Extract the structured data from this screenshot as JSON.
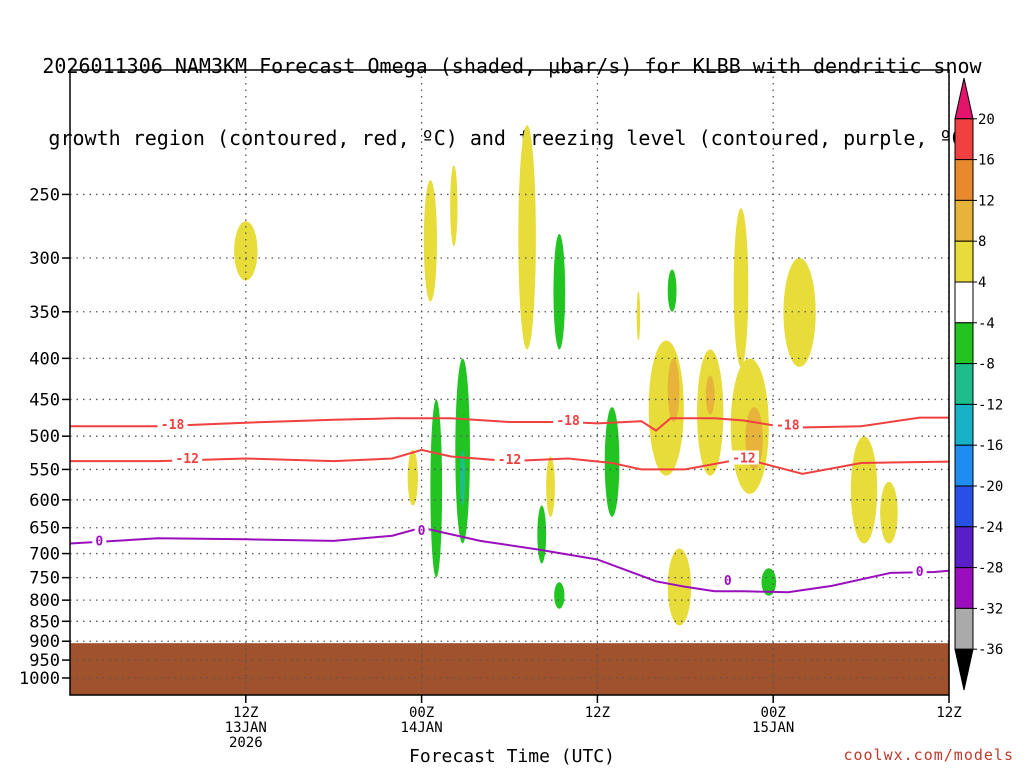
{
  "title_lines": [
    "2026011306 NAM3KM Forecast Omega (shaded, μbar/s) for KLBB with dendritic snow",
    "growth region (contoured, red, ºC) and freezing level (contoured, purple, ºC)"
  ],
  "credit": "coolwx.com/models",
  "chart_data": {
    "type": "heatmap",
    "xlabel": "Forecast Time (UTC)",
    "x_unit": "forecast hour",
    "xlim": [
      -6,
      54
    ],
    "x_ticks": [
      {
        "hour": 6,
        "label": [
          "12Z",
          "13JAN",
          "2026"
        ]
      },
      {
        "hour": 18,
        "label": [
          "00Z",
          "14JAN"
        ]
      },
      {
        "hour": 30,
        "label": [
          "12Z"
        ]
      },
      {
        "hour": 42,
        "label": [
          "00Z",
          "15JAN"
        ]
      },
      {
        "hour": 54,
        "label": [
          "12Z"
        ]
      }
    ],
    "ylabel": "",
    "y_unit": "hPa",
    "ylim": [
      1050,
      175
    ],
    "y_ticks": [
      250,
      300,
      350,
      400,
      450,
      500,
      550,
      600,
      650,
      700,
      750,
      800,
      850,
      900,
      950,
      1000
    ],
    "grid": true,
    "colorbar": {
      "labels": [
        "20",
        "16",
        "12",
        "8",
        "4",
        "-4",
        "-8",
        "-12",
        "-16",
        "-20",
        "-24",
        "-28",
        "-32",
        "-36"
      ],
      "colors": [
        "#e4146c",
        "#f04040",
        "#e8892e",
        "#e8b33a",
        "#e8dc3a",
        "#ffffff",
        "#22c422",
        "#1dbe8c",
        "#17b2c8",
        "#1e8cf0",
        "#2850e6",
        "#5a1ec8",
        "#9b0ebe",
        "#aaaaaa",
        "#000000"
      ]
    },
    "ground": {
      "color": "#a0522d",
      "top_hpa": 905
    },
    "isotherms": [
      {
        "label": "-18",
        "color": "#f04040",
        "points": [
          [
            -6,
            486
          ],
          [
            0,
            486
          ],
          [
            6,
            481
          ],
          [
            12,
            477
          ],
          [
            16,
            475
          ],
          [
            20,
            475
          ],
          [
            24,
            480
          ],
          [
            28,
            480
          ],
          [
            30,
            482
          ],
          [
            33,
            479
          ],
          [
            34,
            492
          ],
          [
            35,
            475
          ],
          [
            38,
            475
          ],
          [
            40,
            478
          ],
          [
            43,
            488
          ],
          [
            48,
            486
          ],
          [
            52,
            474
          ],
          [
            56,
            474
          ],
          [
            60,
            467
          ]
        ],
        "label_at": [
          [
            1,
            484
          ],
          [
            28,
            479
          ],
          [
            43,
            485
          ]
        ]
      },
      {
        "label": "-12",
        "color": "#f04040",
        "points": [
          [
            -6,
            537
          ],
          [
            0,
            537
          ],
          [
            6,
            533
          ],
          [
            12,
            537
          ],
          [
            16,
            533
          ],
          [
            18,
            520
          ],
          [
            20,
            530
          ],
          [
            24,
            537
          ],
          [
            28,
            533
          ],
          [
            31,
            540
          ],
          [
            33,
            550
          ],
          [
            36,
            550
          ],
          [
            40,
            533
          ],
          [
            44,
            557
          ],
          [
            48,
            540
          ],
          [
            56,
            537
          ],
          [
            60,
            520
          ]
        ],
        "label_at": [
          [
            2,
            534
          ],
          [
            24,
            535
          ],
          [
            40,
            533
          ]
        ]
      },
      {
        "label": "0",
        "color": "#9b0ebe",
        "points": [
          [
            -6,
            680
          ],
          [
            0,
            670
          ],
          [
            6,
            672
          ],
          [
            12,
            675
          ],
          [
            16,
            665
          ],
          [
            18,
            650
          ],
          [
            22,
            675
          ],
          [
            26,
            692
          ],
          [
            30,
            712
          ],
          [
            34,
            758
          ],
          [
            36,
            770
          ],
          [
            38,
            780
          ],
          [
            40,
            780
          ],
          [
            43,
            782
          ],
          [
            46,
            768
          ],
          [
            50,
            740
          ],
          [
            53,
            738
          ],
          [
            56,
            730
          ],
          [
            57,
            685
          ],
          [
            60,
            668
          ]
        ],
        "label_at": [
          [
            -4,
            676
          ],
          [
            18,
            656
          ],
          [
            52,
            738
          ]
        ]
      },
      {
        "label": "0",
        "color": "#9b0ebe",
        "points": [
          [
            38.6,
            760
          ],
          [
            39.2,
            762
          ]
        ],
        "label_at": [
          [
            38.9,
            757
          ]
        ]
      }
    ],
    "omega_regions": [
      {
        "value": 4,
        "color": "#e8dc3a",
        "center": [
          6,
          290
        ],
        "half_width_h": 0.8,
        "p_range": [
          270,
          320
        ]
      },
      {
        "value": 4,
        "color": "#e8dc3a",
        "center": [
          18.6,
          290
        ],
        "half_width_h": 0.45,
        "p_range": [
          240,
          340
        ]
      },
      {
        "value": 4,
        "color": "#e8dc3a",
        "center": [
          20.2,
          260
        ],
        "half_width_h": 0.25,
        "p_range": [
          230,
          290
        ]
      },
      {
        "value": 4,
        "color": "#e8dc3a",
        "center": [
          25.2,
          270
        ],
        "half_width_h": 0.6,
        "p_range": [
          205,
          390
        ]
      },
      {
        "value": 4,
        "color": "#e8dc3a",
        "center": [
          17.4,
          560
        ],
        "half_width_h": 0.35,
        "p_range": [
          520,
          610
        ]
      },
      {
        "value": 4,
        "color": "#e8dc3a",
        "center": [
          26.8,
          575
        ],
        "half_width_h": 0.3,
        "p_range": [
          530,
          630
        ]
      },
      {
        "value": 4,
        "color": "#e8dc3a",
        "center": [
          32.8,
          350
        ],
        "half_width_h": 0.12,
        "p_range": [
          330,
          380
        ]
      },
      {
        "value": 4,
        "color": "#e8dc3a",
        "center": [
          34.7,
          450
        ],
        "half_width_h": 1.2,
        "p_range": [
          380,
          560
        ]
      },
      {
        "value": 4,
        "color": "#e8dc3a",
        "center": [
          37.7,
          440
        ],
        "half_width_h": 0.9,
        "p_range": [
          390,
          560
        ]
      },
      {
        "value": 4,
        "color": "#e8dc3a",
        "center": [
          40.4,
          480
        ],
        "half_width_h": 1.3,
        "p_range": [
          400,
          590
        ]
      },
      {
        "value": 4,
        "color": "#e8dc3a",
        "center": [
          39.8,
          320
        ],
        "half_width_h": 0.5,
        "p_range": [
          260,
          410
        ]
      },
      {
        "value": 4,
        "color": "#e8dc3a",
        "center": [
          43.8,
          340
        ],
        "half_width_h": 1.1,
        "p_range": [
          300,
          410
        ]
      },
      {
        "value": 4,
        "color": "#e8dc3a",
        "center": [
          35.6,
          770
        ],
        "half_width_h": 0.8,
        "p_range": [
          690,
          860
        ]
      },
      {
        "value": 4,
        "color": "#e8dc3a",
        "center": [
          48.2,
          590
        ],
        "half_width_h": 0.9,
        "p_range": [
          500,
          680
        ]
      },
      {
        "value": 4,
        "color": "#e8dc3a",
        "center": [
          49.9,
          620
        ],
        "half_width_h": 0.6,
        "p_range": [
          570,
          680
        ]
      },
      {
        "value": 8,
        "color": "#e8b33a",
        "center": [
          35.2,
          440
        ],
        "half_width_h": 0.4,
        "p_range": [
          400,
          480
        ]
      },
      {
        "value": 8,
        "color": "#e8b33a",
        "center": [
          37.7,
          440
        ],
        "half_width_h": 0.3,
        "p_range": [
          420,
          470
        ]
      },
      {
        "value": 8,
        "color": "#e8b33a",
        "center": [
          40.7,
          500
        ],
        "half_width_h": 0.6,
        "p_range": [
          460,
          550
        ]
      },
      {
        "value": -4,
        "color": "#22c422",
        "center": [
          19.0,
          600
        ],
        "half_width_h": 0.4,
        "p_range": [
          450,
          750
        ]
      },
      {
        "value": -4,
        "color": "#22c422",
        "center": [
          20.8,
          520
        ],
        "half_width_h": 0.5,
        "p_range": [
          400,
          680
        ]
      },
      {
        "value": -4,
        "color": "#22c422",
        "center": [
          27.4,
          335
        ],
        "half_width_h": 0.4,
        "p_range": [
          280,
          390
        ]
      },
      {
        "value": -4,
        "color": "#22c422",
        "center": [
          31.0,
          510
        ],
        "half_width_h": 0.5,
        "p_range": [
          460,
          630
        ]
      },
      {
        "value": -4,
        "color": "#22c422",
        "center": [
          26.2,
          660
        ],
        "half_width_h": 0.3,
        "p_range": [
          610,
          720
        ]
      },
      {
        "value": -4,
        "color": "#22c422",
        "center": [
          27.4,
          790
        ],
        "half_width_h": 0.35,
        "p_range": [
          760,
          820
        ]
      },
      {
        "value": -4,
        "color": "#22c422",
        "center": [
          35.1,
          325
        ],
        "half_width_h": 0.3,
        "p_range": [
          310,
          350
        ]
      },
      {
        "value": -4,
        "color": "#22c422",
        "center": [
          41.7,
          760
        ],
        "half_width_h": 0.5,
        "p_range": [
          730,
          790
        ]
      },
      {
        "value": -8,
        "color": "#1dbe8c",
        "center": [
          20.8,
          560
        ],
        "half_width_h": 0.18,
        "p_range": [
          520,
          610
        ]
      }
    ]
  }
}
